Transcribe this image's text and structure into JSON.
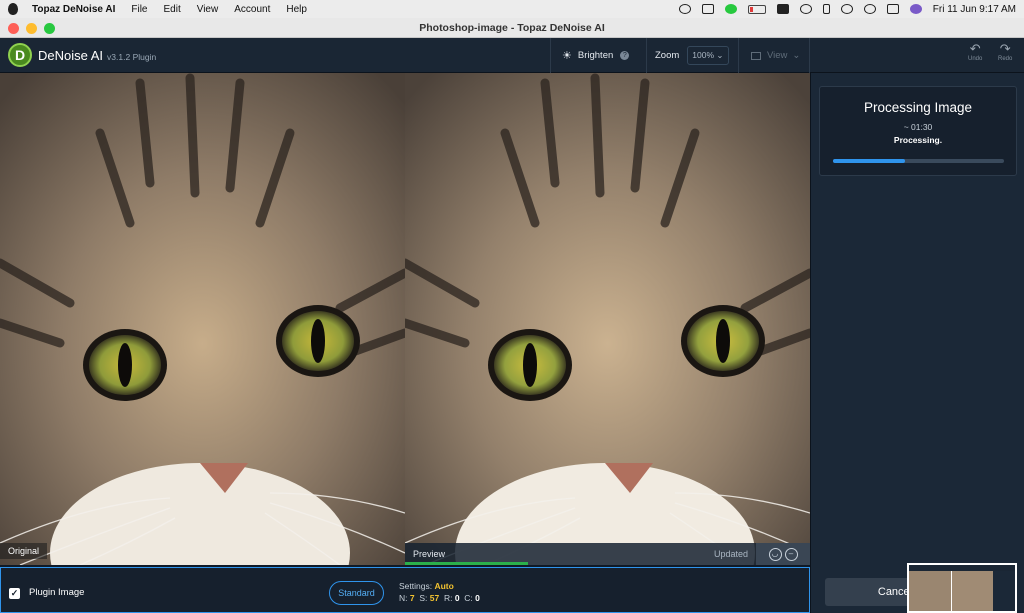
{
  "menubar": {
    "app_name": "Topaz DeNoise AI",
    "items": [
      "File",
      "Edit",
      "View",
      "Account",
      "Help"
    ],
    "datetime": "Fri 11 Jun  9:17 AM"
  },
  "window": {
    "title": "Photoshop-image - Topaz DeNoise AI"
  },
  "app": {
    "name": "DeNoise AI",
    "version": "v3.1.2 Plugin",
    "logo_letter": "D"
  },
  "toolbar": {
    "brighten": "Brighten",
    "zoom_label": "Zoom",
    "zoom_value": "100%",
    "view_label": "View",
    "undo": "Undo",
    "redo": "Redo"
  },
  "canvas": {
    "left_label": "Original",
    "right_label": "Preview",
    "right_status": "Updated",
    "preview_progress_fraction": 0.35
  },
  "processing": {
    "title": "Processing Image",
    "time": "~ 01:30",
    "status": "Processing.",
    "progress_fraction": 0.42
  },
  "bottom": {
    "plugin_label": "Plugin Image",
    "mode_button": "Standard",
    "settings_label": "Settings:",
    "settings_value": "Auto",
    "n_label": "N:",
    "n_value": "7",
    "s_label": "S:",
    "s_value": "57",
    "r_label": "R:",
    "r_value": "0",
    "c_label": "C:",
    "c_value": "0"
  },
  "cancel_button": "Cancel",
  "colors": {
    "accent": "#2f94ec",
    "highlight": "#f2c230",
    "progress_green": "#2bb04b",
    "bg": "#1b2837"
  }
}
